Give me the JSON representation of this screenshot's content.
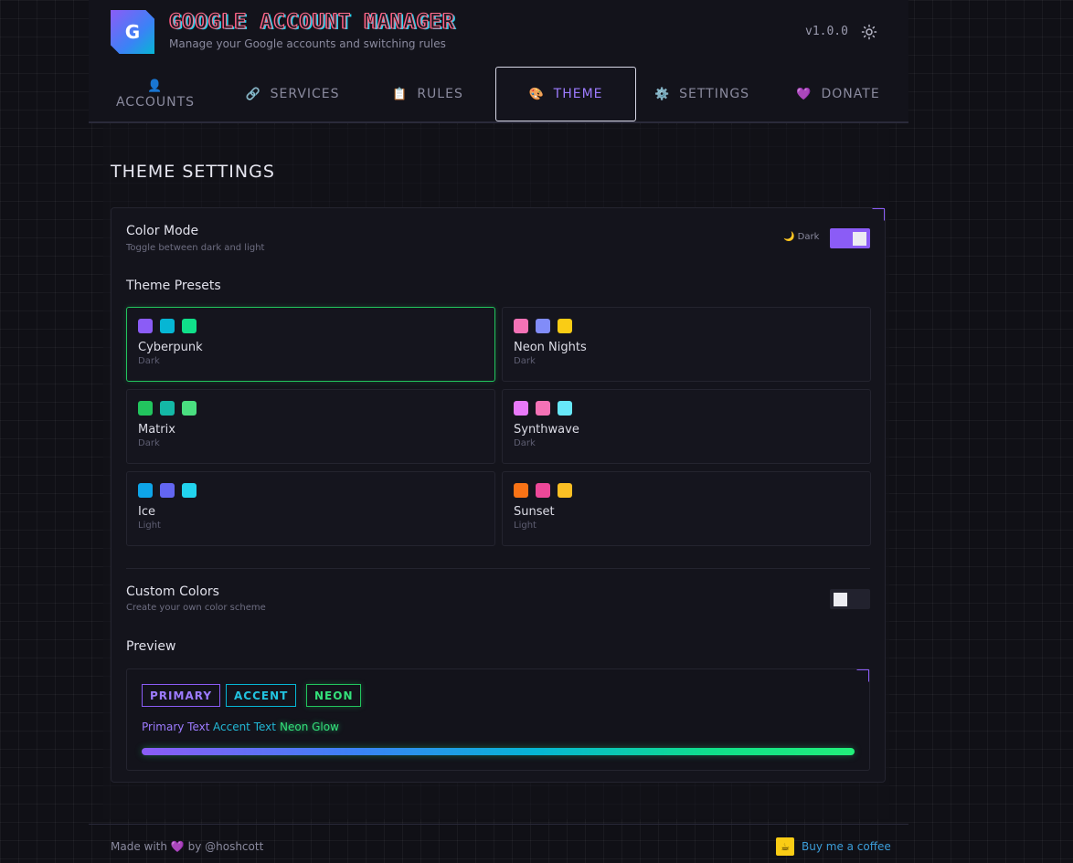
{
  "header": {
    "logo_letter": "G",
    "title": "GOOGLE ACCOUNT MANAGER",
    "subtitle": "Manage your Google accounts and switching rules",
    "version": "v1.0.0"
  },
  "nav": {
    "tabs": [
      {
        "icon": "👤",
        "label": "ACCOUNTS"
      },
      {
        "icon": "🔗",
        "label": "SERVICES"
      },
      {
        "icon": "📋",
        "label": "RULES"
      },
      {
        "icon": "🎨",
        "label": "THEME"
      },
      {
        "icon": "⚙️",
        "label": "SETTINGS"
      },
      {
        "icon": "💜",
        "label": "DONATE"
      }
    ],
    "active": "THEME"
  },
  "theme": {
    "section_title": "THEME SETTINGS",
    "color_mode": {
      "title": "Color Mode",
      "subtitle": "Toggle between dark and light",
      "mode_icon": "🌙",
      "mode_label": "Dark",
      "enabled": true
    },
    "presets_title": "Theme Presets",
    "presets": [
      {
        "name": "Cyberpunk",
        "mode": "Dark",
        "colors": [
          "#8b5cf6",
          "#06b6d4",
          "#10e08a"
        ],
        "selected": true
      },
      {
        "name": "Neon Nights",
        "mode": "Dark",
        "colors": [
          "#f472b6",
          "#818cf8",
          "#facc15"
        ],
        "selected": false
      },
      {
        "name": "Matrix",
        "mode": "Dark",
        "colors": [
          "#22c55e",
          "#14b8a6",
          "#4ade80"
        ],
        "selected": false
      },
      {
        "name": "Synthwave",
        "mode": "Dark",
        "colors": [
          "#e879f9",
          "#f472b6",
          "#67e8f9"
        ],
        "selected": false
      },
      {
        "name": "Ice",
        "mode": "Light",
        "colors": [
          "#0ea5e9",
          "#6366f1",
          "#22d3ee"
        ],
        "selected": false
      },
      {
        "name": "Sunset",
        "mode": "Light",
        "colors": [
          "#f97316",
          "#ec4899",
          "#fbbf24"
        ],
        "selected": false
      }
    ],
    "custom_colors": {
      "title": "Custom Colors",
      "subtitle": "Create your own color scheme",
      "enabled": false
    },
    "preview": {
      "title": "Preview",
      "btn_primary": "PRIMARY",
      "btn_accent": "ACCENT",
      "btn_neon": "NEON",
      "text_primary": "Primary Text",
      "text_accent": "Accent Text",
      "text_neon": "Neon Glow"
    }
  },
  "colors": {
    "primary": "#8b5cf6",
    "accent": "#06b6d4",
    "neon": "#22c55e"
  },
  "footer": {
    "made_with": "Made with",
    "heart": "💜",
    "by": "by @hoshcott",
    "coffee_icon": "coffee-cup-icon",
    "coffee_label": "Buy me a coffee"
  }
}
